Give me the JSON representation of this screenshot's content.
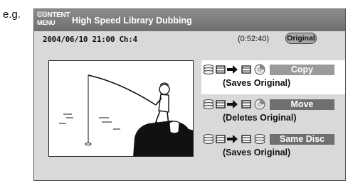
{
  "caption": "e.g.",
  "header": {
    "menu_line1": "CONTENT",
    "menu_line2": "MENU",
    "title": "High Speed Library Dubbing"
  },
  "info": {
    "datetime": "2004/06/10 21:00 Ch:4",
    "duration": "(0:52:40)",
    "badge": "Original"
  },
  "options": [
    {
      "label": "Copy",
      "sub": "(Saves Original)",
      "selected": true,
      "icons": [
        "hdd-icon",
        "tape-icon",
        "arrow-icon",
        "tape-icon",
        "dvd-icon"
      ]
    },
    {
      "label": "Move",
      "sub": "(Deletes Original)",
      "selected": false,
      "icons": [
        "hdd-icon",
        "tape-icon",
        "arrow-icon",
        "tape-icon",
        "dvd-icon"
      ]
    },
    {
      "label": "Same Disc",
      "sub": "(Saves Original)",
      "selected": false,
      "icons": [
        "hdd-icon",
        "tape-icon",
        "arrow-icon",
        "tape-icon",
        "hdd-icon"
      ]
    }
  ],
  "colors": {
    "title_bar": "#7a7a7a",
    "screen_bg": "#d9d9d9",
    "label_selected": "#9a9a9a",
    "label_normal": "#6f6f6f"
  }
}
